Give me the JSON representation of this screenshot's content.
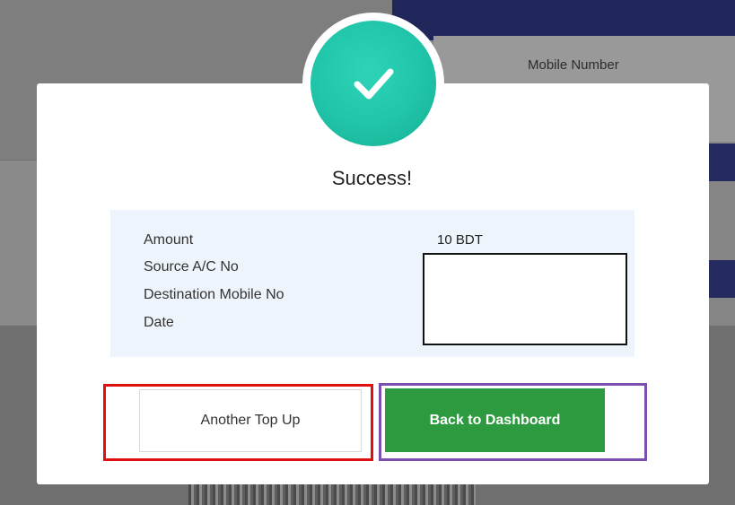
{
  "background": {
    "mobile_number_label": "Mobile Number"
  },
  "modal": {
    "title": "Success!",
    "status_icon": "checkmark-icon",
    "accent_color": "#20c4a8",
    "details": {
      "labels": {
        "amount": "Amount",
        "source_account": "Source A/C No",
        "destination_mobile": "Destination Mobile No",
        "date": "Date"
      },
      "values": {
        "amount": "10 BDT"
      }
    },
    "buttons": {
      "another_top_up": "Another Top Up",
      "back_to_dashboard": "Back to Dashboard"
    },
    "primary_color": "#2e9a3f"
  }
}
